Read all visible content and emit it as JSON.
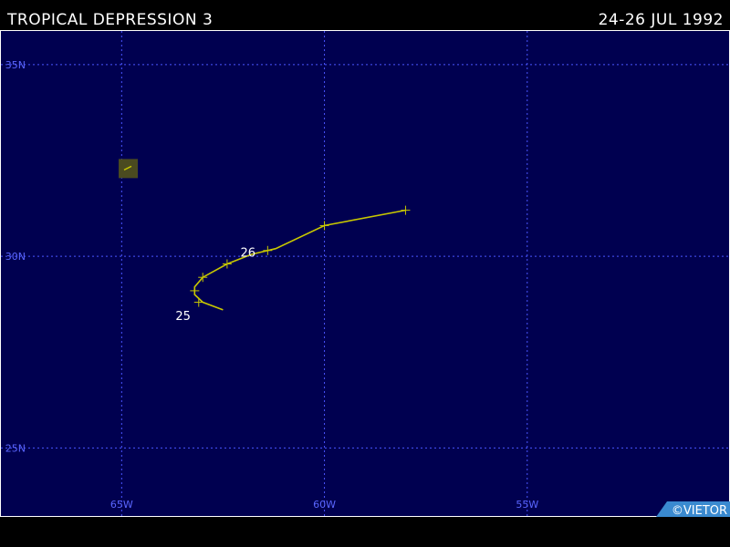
{
  "header": {
    "title": "TROPICAL DEPRESSION 3",
    "dates": "24-26 JUL 1992"
  },
  "map": {
    "lon_range": [
      -68,
      -50
    ],
    "lat_range": [
      23.2,
      35.9
    ],
    "background": "#000050",
    "border_color": "#ffffff",
    "grid_color": "#4a55ff",
    "track_color": "#c8c800",
    "gridlines_lon": [
      -65,
      -60,
      -55
    ],
    "gridlines_lat": [
      35,
      30,
      25
    ],
    "lon_labels": [
      "65W",
      "60W",
      "55W"
    ],
    "lat_labels": [
      "35N",
      "30N",
      "25N"
    ]
  },
  "track": [
    {
      "lon": -62.5,
      "lat": 28.6
    },
    {
      "lon": -63.0,
      "lat": 28.8
    },
    {
      "lon": -63.2,
      "lat": 29.0
    },
    {
      "lon": -63.2,
      "lat": 29.2
    },
    {
      "lon": -63.0,
      "lat": 29.45
    },
    {
      "lon": -62.4,
      "lat": 29.8
    },
    {
      "lon": -61.8,
      "lat": 30.05
    },
    {
      "lon": -61.2,
      "lat": 30.2
    },
    {
      "lon": -60.0,
      "lat": 30.8
    },
    {
      "lon": -58.0,
      "lat": 31.2
    }
  ],
  "track_marks": [
    {
      "lon": -63.1,
      "lat": 28.8
    },
    {
      "lon": -63.2,
      "lat": 29.1
    },
    {
      "lon": -63.0,
      "lat": 29.45
    },
    {
      "lon": -62.4,
      "lat": 29.8
    },
    {
      "lon": -61.4,
      "lat": 30.15
    },
    {
      "lon": -60.0,
      "lat": 30.8
    },
    {
      "lon": -58.0,
      "lat": 31.2
    }
  ],
  "day_labels": [
    {
      "text": "25",
      "lon": -63.3,
      "lat": 28.65
    },
    {
      "text": "26",
      "lon": -61.7,
      "lat": 30.3
    }
  ],
  "inset": {
    "lon": -64.85,
    "lat": 32.3,
    "color": "#4a4a20"
  },
  "credit": {
    "text": "©VIETOR",
    "color": "#3a8ad0"
  }
}
